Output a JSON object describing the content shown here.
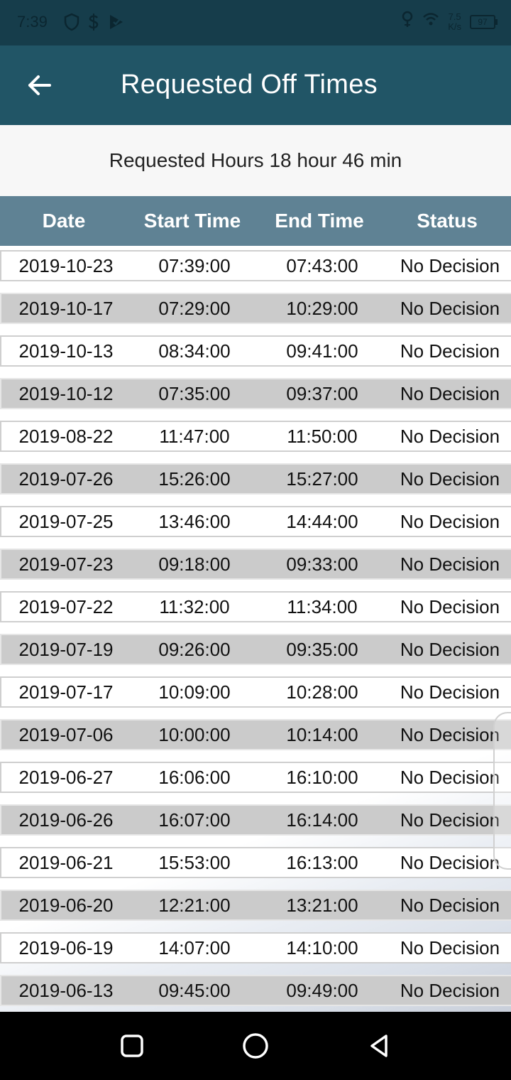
{
  "status_bar": {
    "time": "7:39",
    "net_speed_value": "7.5",
    "net_speed_unit": "K/s",
    "battery": "97",
    "icons": [
      "shield-icon",
      "dollar-icon",
      "play-check-icon",
      "location-pin-icon",
      "wifi-icon"
    ]
  },
  "app_bar": {
    "title": "Requested Off Times",
    "back_icon": "arrow-left-icon"
  },
  "summary": {
    "text": "Requested Hours 18 hour 46 min"
  },
  "table": {
    "headers": [
      "Date",
      "Start Time",
      "End Time",
      "Status"
    ],
    "rows": [
      [
        "2019-10-23",
        "07:39:00",
        "07:43:00",
        "No Decision"
      ],
      [
        "2019-10-17",
        "07:29:00",
        "10:29:00",
        "No Decision"
      ],
      [
        "2019-10-13",
        "08:34:00",
        "09:41:00",
        "No Decision"
      ],
      [
        "2019-10-12",
        "07:35:00",
        "09:37:00",
        "No Decision"
      ],
      [
        "2019-08-22",
        "11:47:00",
        "11:50:00",
        "No Decision"
      ],
      [
        "2019-07-26",
        "15:26:00",
        "15:27:00",
        "No Decision"
      ],
      [
        "2019-07-25",
        "13:46:00",
        "14:44:00",
        "No Decision"
      ],
      [
        "2019-07-23",
        "09:18:00",
        "09:33:00",
        "No Decision"
      ],
      [
        "2019-07-22",
        "11:32:00",
        "11:34:00",
        "No Decision"
      ],
      [
        "2019-07-19",
        "09:26:00",
        "09:35:00",
        "No Decision"
      ],
      [
        "2019-07-17",
        "10:09:00",
        "10:28:00",
        "No Decision"
      ],
      [
        "2019-07-06",
        "10:00:00",
        "10:14:00",
        "No Decision"
      ],
      [
        "2019-06-27",
        "16:06:00",
        "16:10:00",
        "No Decision"
      ],
      [
        "2019-06-26",
        "16:07:00",
        "16:14:00",
        "No Decision"
      ],
      [
        "2019-06-21",
        "15:53:00",
        "16:13:00",
        "No Decision"
      ],
      [
        "2019-06-20",
        "12:21:00",
        "13:21:00",
        "No Decision"
      ],
      [
        "2019-06-19",
        "14:07:00",
        "14:10:00",
        "No Decision"
      ],
      [
        "2019-06-13",
        "09:45:00",
        "09:49:00",
        "No Decision"
      ]
    ]
  },
  "nav_bar": {
    "buttons": [
      "recents-square-icon",
      "home-circle-icon",
      "back-triangle-icon"
    ]
  },
  "colors": {
    "status_bar": "#163d4b",
    "app_bar": "#215566",
    "table_header": "#5f8294",
    "row_alt": "#cbcbcb"
  }
}
